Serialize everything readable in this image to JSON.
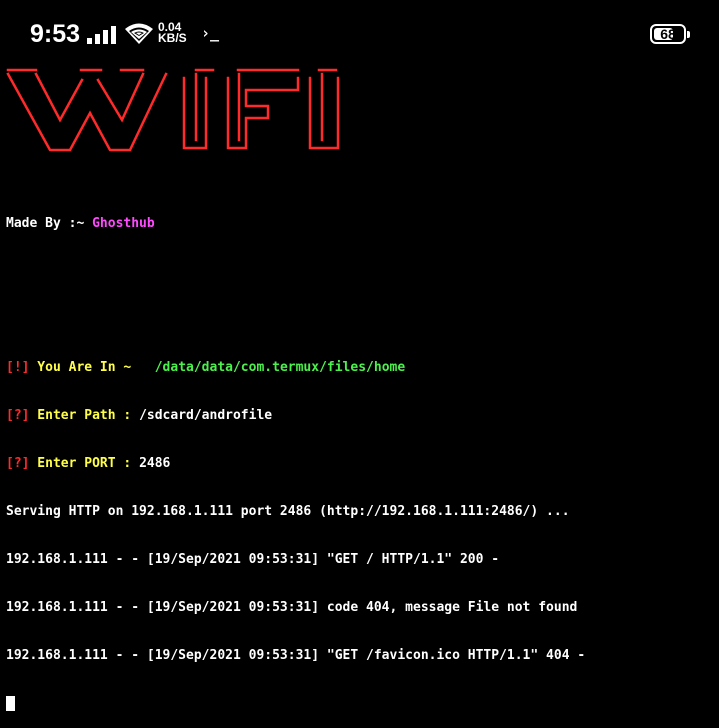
{
  "status_bar": {
    "time": "9:53",
    "speed_value": "0.04",
    "speed_unit": "KB/S",
    "prompt_glyph": "›_",
    "battery_level": "68",
    "icons": [
      "signal-icon",
      "wifi-icon",
      "terminal-prompt-icon",
      "battery-icon"
    ]
  },
  "banner": {
    "text": "WIFI",
    "color": "#ff2a2a"
  },
  "terminal": {
    "author_prefix": "Made By :~ ",
    "author_name": "Ghosthub",
    "location_tag": "[!]",
    "location_label": " You Are In ~   ",
    "location_path": "/data/data/com.termux/files/home",
    "path_tag": "[?]",
    "path_label": " Enter Path : ",
    "path_value": "/sdcard/androfile",
    "port_tag": "[?]",
    "port_label": " Enter PORT : ",
    "port_value": "2486",
    "log_lines": [
      "Serving HTTP on 192.168.1.111 port 2486 (http://192.168.1.111:2486/) ...",
      "192.168.1.111 - - [19/Sep/2021 09:53:31] \"GET / HTTP/1.1\" 200 -",
      "192.168.1.111 - - [19/Sep/2021 09:53:31] code 404, message File not found",
      "192.168.1.111 - - [19/Sep/2021 09:53:31] \"GET /favicon.ico HTTP/1.1\" 404 -"
    ]
  },
  "colors": {
    "background": "#000000",
    "red": "#ff2a2a",
    "yellow": "#ffff4a",
    "green": "#4cf04c",
    "magenta": "#ff4aff"
  }
}
